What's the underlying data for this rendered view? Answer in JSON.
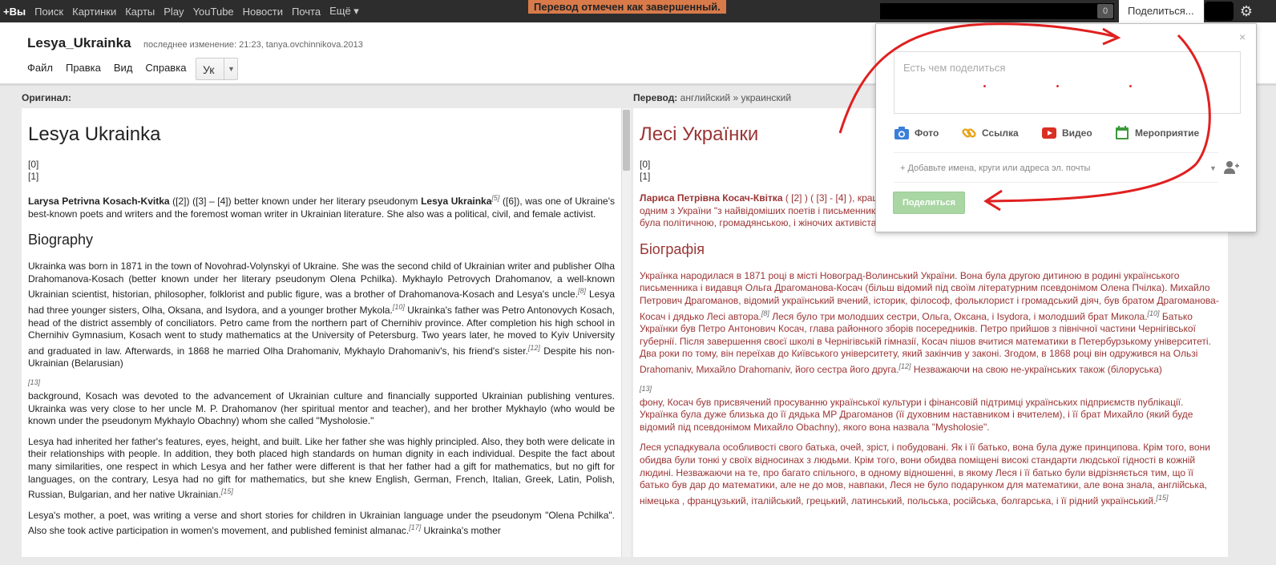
{
  "topbar": {
    "links": [
      "+Вы",
      "Поиск",
      "Картинки",
      "Карты",
      "Play",
      "YouTube",
      "Новости",
      "Почта",
      "Ещё ▾"
    ],
    "status_banner": "Перевод отмечен как завершенный.",
    "notifications": "0",
    "share_tab": "Поделиться...",
    "gear": "⚙"
  },
  "doc": {
    "title": "Lesya_Ukrainka",
    "meta": "последнее изменение: 21:23, tanya.ovchinnikova.2013",
    "menu": [
      "Файл",
      "Правка",
      "Вид",
      "Справка"
    ],
    "lang_value": "Ук"
  },
  "original": {
    "label": "Оригинал:",
    "heading": "Lesya Ukrainka",
    "refs": [
      "[0]",
      "[1]"
    ],
    "intro_bold1": "Larysa Petrivna Kosach-Kvitka",
    "intro_mid": " ([2]) ([3] – [4]) better known under her literary pseudonym ",
    "intro_bold2": "Lesya Ukrainka",
    "intro_sup": "[5]",
    "intro_end": " ([6]), was one of Ukraine's best-known poets and writers and the foremost woman writer in Ukrainian literature. She also was a political, civil, and female activist.",
    "bio_heading": "Biography",
    "p1a": "Ukrainka was born in 1871 in the town of Novohrad-Volynskyi of Ukraine. She was the second child of Ukrainian writer and publisher Olha Drahomanova-Kosach (better known under her literary pseudonym Olena Pchilka). Mykhaylo Petrovych Drahomanov, a well-known Ukrainian scientist, historian, philosopher, folklorist and public figure, was a brother of Drahomanova-Kosach and Lesya's uncle.",
    "p1_sup1": "[8]",
    "p1b": " Lesya had three younger sisters, Olha, Oksana, and Isydora, and a younger brother Mykola.",
    "p1_sup2": "[10]",
    "p1c": " Ukrainka's father was Petro Antonovych Kosach, head of the district assembly of conciliators. Petro came from the northern part of Chernihiv province. After completion his high school in Chernihiv Gymnasium, Kosach went to study mathematics at the University of Petersburg. Two years later, he moved to Kyiv University and graduated in law. Afterwards, in 1868 he married Olha Drahomaniv, Mykhaylo Drahomaniv's, his friend's sister.",
    "p1_sup3": "[12]",
    "p1d": " Despite his non-Ukrainian (Belarusian)",
    "foot1": "[13]",
    "p2": "background, Kosach was devoted to the advancement of Ukrainian culture and financially supported Ukrainian publishing ventures. Ukrainka was very close to her uncle M. P. Drahomanov (her spiritual mentor and teacher), and her brother Mykhaylo (who would be known under the pseudonym Mykhaylo Obachny) whom she called \"Mysholosie.\"",
    "p3": "Lesya had inherited her father's features, eyes, height, and built. Like her father she was highly principled. Also, they both were delicate in their relationships with people. In addition, they both placed high standards on human dignity in each individual. Despite the fact about many similarities, one respect in which Lesya and her father were different is that her father had a gift for mathematics, but no gift for languages, on the contrary, Lesya had no gift for mathematics, but she knew English, German, French, Italian, Greek, Latin, Polish, Russian, Bulgarian, and her native Ukrainian.",
    "p3_sup": "[15]",
    "p4": "Lesya's mother, a poet, was writing a verse and short stories for children in Ukrainian language under the pseudonym \"Olena Pchilka\". Also she took active participation in women's movement, and published feminist almanac.",
    "p4_sup": "[17]",
    "p4b": " Ukrainka's mother"
  },
  "translation": {
    "label": "Перевод:",
    "pair": "английский  »  украинский",
    "heading": "Лесі Українки",
    "refs": [
      "[0]",
      "[1]"
    ],
    "intro_bold": "Лариса Петрівна Косач-Квітка",
    "intro": " ( [2] ) ( [3] - [4] ), краще відома під своїм літературним псевдонімом Леся Українка [5] ( [6] ), був одним з України \"з найвідоміших поетів і письменників, і в першу чергу жінка письменник в українській літературі. Вона також була політичною, громадянською, і жіночих активіста.",
    "bio_heading": "Біографія",
    "p1a": "Українка народилася в 1871 році в місті Новоград-Волинський України. Вона була другою дитиною в родині українського письменника і видавця Ольга Драгоманова-Косач (більш відомий під своїм літературним псевдонімом Олена Пчілка). Михайло Петрович Драгоманов, відомий український вчений, історик, філософ, фольклорист і громадський діяч, був братом Драгоманова-Косач і дядько Лесі автора.",
    "p1_sup1": "[8]",
    "p1b": " Леся було три молодших сестри, Ольга, Оксана, і Isydora, і молодший брат Микола.",
    "p1_sup2": "[10]",
    "p1c": " Батько Українки був Петро Антонович Косач, глава районного зборів посередників. Петро прийшов з північної частини Чернігівської губернії. Після завершення своєї школі в Чернігівській гімназії, Косач пішов вчитися математики в Петербурзькому університеті. Два роки по тому, він переїхав до Київського університету, який закінчив у законі. Згодом, в 1868 році він одружився на Ользі Drahomaniv, Михайло Drahomaniv, його сестра його друга.",
    "p1_sup3": "[12]",
    "p1d": " Незважаючи на свою не-українських також (білоруська)",
    "foot1": "[13]",
    "p2": "фону, Косач був присвячений просуванню української культури і фінансовій підтримці українських підприємств публікації. Українка була дуже близька до її дядька MP Драгоманов (її духовним наставником і вчителем), і її брат Михайло (який буде відомий під псевдонімом Михайло Obachny), якого вона назвала \"Mysholosie\".",
    "p3": "Леся успадкувала особливості свого батька, очей, зріст, і побудовані. Як і її батько, вона була дуже принципова. Крім того, вони обидва були тонкі у своїх відносинах з людьми. Крім того, вони обидва поміщені високі стандарти людської гідності в кожній людині. Незважаючи на те, про багато спільного, в одному відношенні, в якому Леся і її батько були відрізняється тим, що її батько був дар до математики, але не до мов, навпаки, Леся не було подарунком для математики, але вона знала, англійська, німецька , французький, італійський, грецький, латинський, польська, російська, болгарська, і її рідний український.",
    "p3_sup": "[15]"
  },
  "share": {
    "close": "×",
    "placeholder": "Есть чем поделиться",
    "options": {
      "photo": "Фото",
      "link": "Ссылка",
      "video": "Видео",
      "event": "Мероприятие"
    },
    "to_placeholder": "+ Добавьте имена, круги или адреса эл. почты",
    "button": "Поделиться"
  },
  "colors": {
    "banner": "#d87a4a",
    "translation_text": "#9b3434",
    "share_button": "#a9d6a3",
    "annotation": "#e02020"
  }
}
